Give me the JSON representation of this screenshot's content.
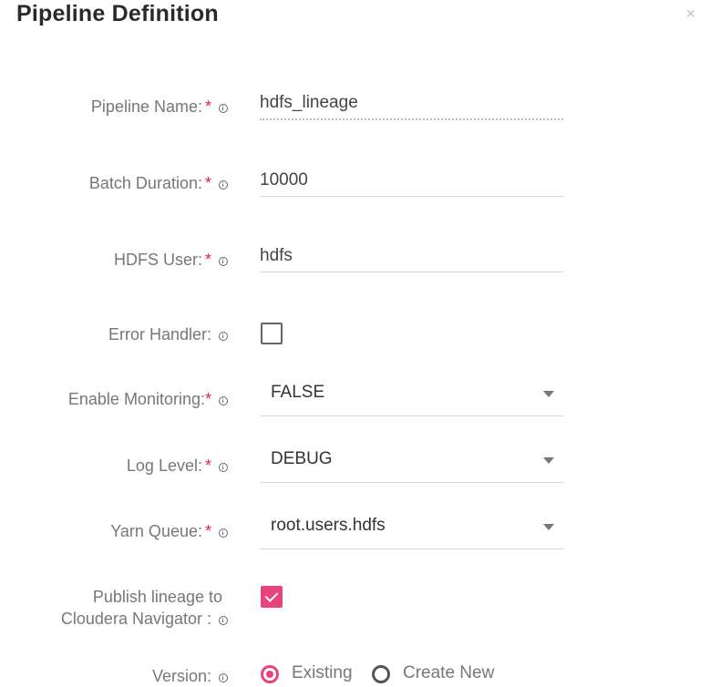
{
  "dialog": {
    "title": "Pipeline Definition",
    "close_glyph": "×"
  },
  "fields": {
    "pipeline_name": {
      "label": "Pipeline Name:",
      "required_mark": "*",
      "value": "hdfs_lineage"
    },
    "batch_duration": {
      "label": "Batch Duration:",
      "required_mark": "*",
      "value": "10000"
    },
    "hdfs_user": {
      "label": "HDFS User:",
      "required_mark": "*",
      "value": "hdfs"
    },
    "error_handler": {
      "label": "Error Handler:",
      "checked": false
    },
    "enable_monitoring": {
      "label": "Enable Monitoring:",
      "required_mark": "*",
      "selected": "FALSE"
    },
    "log_level": {
      "label": "Log Level:",
      "required_mark": "*",
      "selected": "DEBUG"
    },
    "yarn_queue": {
      "label": "Yarn Queue:",
      "required_mark": "*",
      "selected": "root.users.hdfs"
    },
    "publish_lineage": {
      "label_line1": "Publish lineage to",
      "label_line2": "Cloudera Navigator :",
      "checked": true
    },
    "version": {
      "label": "Version:",
      "options": [
        {
          "label": "Existing",
          "selected": true
        },
        {
          "label": "Create New",
          "selected": false
        }
      ]
    }
  },
  "colors": {
    "accent": "#e8447a",
    "required": "#e0244f",
    "label": "#777777"
  }
}
